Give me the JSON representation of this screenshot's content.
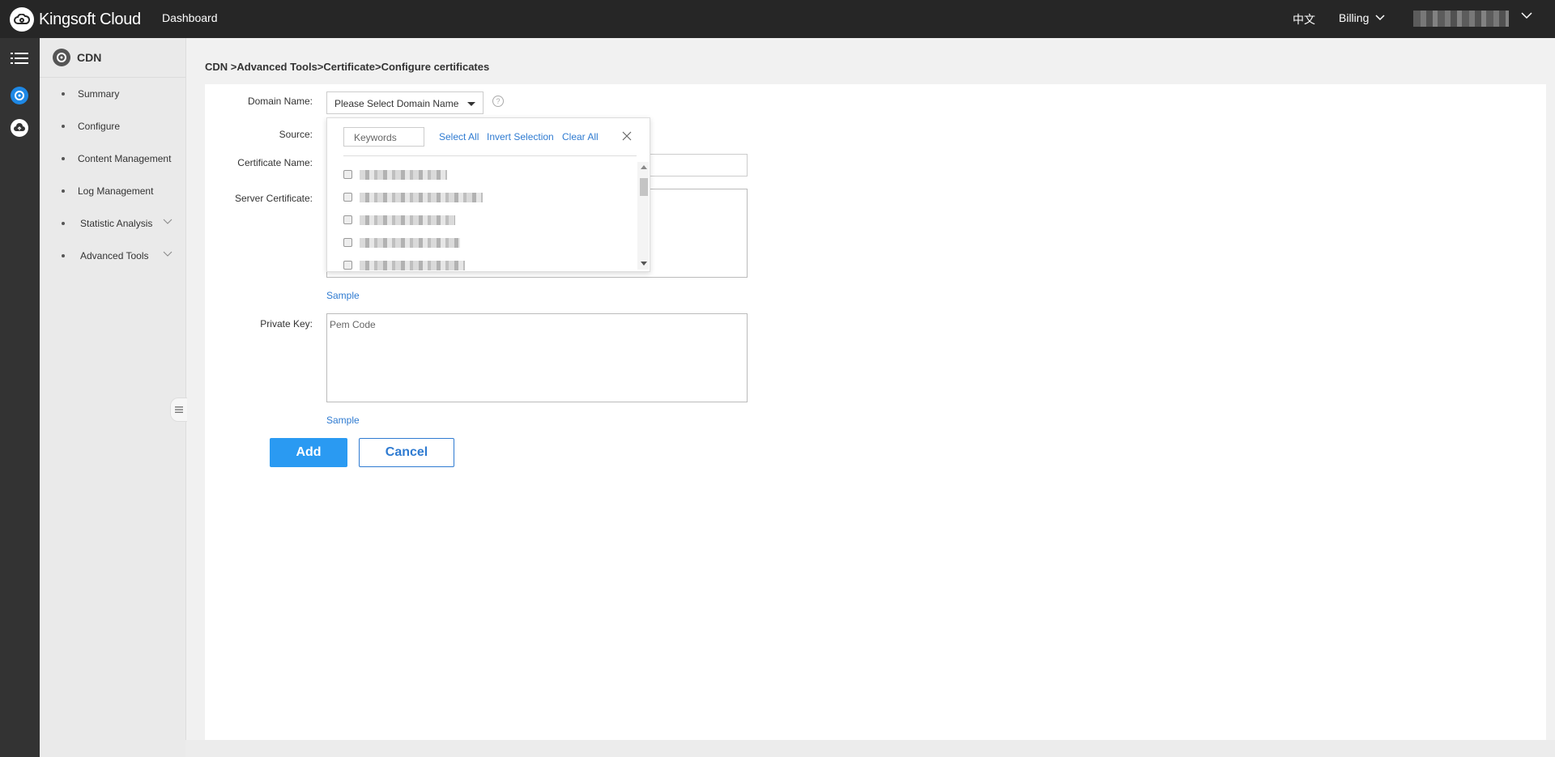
{
  "topbar": {
    "brand": "Kingsoft Cloud",
    "dashboard": "Dashboard",
    "language": "中文",
    "billing": "Billing"
  },
  "sidebar": {
    "title": "CDN",
    "items": [
      {
        "label": "Summary"
      },
      {
        "label": "Configure"
      },
      {
        "label": "Content Management"
      },
      {
        "label": "Log Management"
      },
      {
        "label": "Statistic Analysis"
      },
      {
        "label": "Advanced Tools"
      }
    ]
  },
  "breadcrumb": "CDN >Advanced Tools>Certificate>Configure certificates",
  "form": {
    "domain_label": "Domain Name:",
    "domain_placeholder": "Please Select Domain Name",
    "source_label": "Source:",
    "cert_name_label": "Certificate Name:",
    "server_cert_label": "Server Certificate:",
    "private_key_label": "Private Key:",
    "private_key_placeholder": "Pem Code",
    "sample_link_1": "Sample",
    "sample_link_2": "Sample",
    "add_button": "Add",
    "cancel_button": "Cancel"
  },
  "dropdown": {
    "search_placeholder": "Keywords",
    "select_all": "Select All",
    "invert_selection": "Invert Selection",
    "clear_all": "Clear All"
  },
  "colors": {
    "accent": "#2a9af2",
    "link": "#2f7bd1",
    "topbar_bg": "#262626",
    "rail_bg": "#333333",
    "active_icon": "#1e88e5"
  },
  "icons": [
    "kingsoft-cloud-logo",
    "menu-icon",
    "cdn-icon",
    "cloud-upload-icon",
    "chevron-down-icon",
    "help-icon",
    "close-icon",
    "collapse-icon"
  ]
}
